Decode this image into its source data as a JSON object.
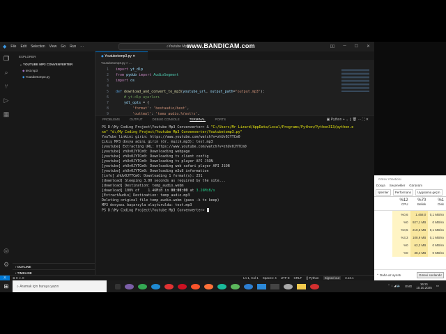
{
  "titlebar": {
    "menus": [
      "File",
      "Edit",
      "Selection",
      "View",
      "Go",
      "Run",
      "···"
    ],
    "search": "Youtube Mp3",
    "watermark": "www.BANDICAM.com"
  },
  "sidebar": {
    "header": "EXPLORER",
    "folder": "YOUTUBE MP3 CONVENVERTER",
    "files": [
      "test.mp3",
      "Youtubetomp3.py"
    ],
    "outline": "OUTLINE",
    "timeline": "TIMELINE"
  },
  "editor": {
    "tab": "Youtubetomp3.py",
    "breadcrumb": "Youtubetomp3.py > ...",
    "lines": [
      [
        {
          "c": "kw",
          "t": "import "
        },
        {
          "c": "vr",
          "t": "yt_dlp"
        }
      ],
      [
        {
          "c": "kw",
          "t": "from "
        },
        {
          "c": "vr",
          "t": "pydub "
        },
        {
          "c": "kw",
          "t": "import "
        },
        {
          "c": "cl",
          "t": "AudioSegment"
        }
      ],
      [
        {
          "c": "kw",
          "t": "import "
        },
        {
          "c": "vr",
          "t": "os"
        }
      ],
      [],
      [
        {
          "c": "bl",
          "t": "def "
        },
        {
          "c": "fn",
          "t": "download_and_convert_to_mp3"
        },
        {
          "c": "",
          "t": "("
        },
        {
          "c": "vr",
          "t": "youtube_url"
        },
        {
          "c": "",
          "t": ", "
        },
        {
          "c": "vr",
          "t": "output_path"
        },
        {
          "c": "",
          "t": "="
        },
        {
          "c": "st",
          "t": "\"output.mp3\""
        },
        {
          "c": "",
          "t": "):"
        }
      ],
      [
        {
          "c": "cm",
          "t": "    # yt-dlp ayarları"
        }
      ],
      [
        {
          "c": "vr",
          "t": "    ydl_opts"
        },
        {
          "c": "",
          "t": " = {"
        }
      ],
      [
        {
          "c": "st",
          "t": "        'format'"
        },
        {
          "c": "",
          "t": ": "
        },
        {
          "c": "st",
          "t": "'bestaudio/best'"
        },
        {
          "c": "",
          "t": ","
        }
      ],
      [
        {
          "c": "st",
          "t": "        'outtmpl'"
        },
        {
          "c": "",
          "t": ": "
        },
        {
          "c": "st",
          "t": "'temp_audio.%(ext)s'"
        },
        {
          "c": "",
          "t": ","
        }
      ]
    ]
  },
  "panel": {
    "tabs": [
      "PROBLEMS",
      "OUTPUT",
      "DEBUG CONSOLE",
      "TERMINAL",
      "PORTS"
    ],
    "shell": "Python",
    "terminal": [
      "PS D:\\My Coding Project\\Youtube Mp3 Convenverter> & \"C:/Users/Mr Lizard/AppData/Local/Programs/Python/Python313/python.e",
      "xe\" \"d:/My Coding Project/Youtube Mp3 Convenverter/Youtubetomp3.py\"",
      "YouTube linkini girin: https://www.youtube.com/watch?v=zhUv0JYTCm0",
      "Çıkış MP3 dosya adını girin (ör. muzik.mp3): test.mp3",
      "[youtube] Extracting URL: https://www.youtube.com/watch?v=zhUv0JYTCm0",
      "[youtube] zhUv0JYTCm0: Downloading webpage",
      "[youtube] zhUv0JYTCm0: Downloading tv client config",
      "[youtube] zhUv0JYTCm0: Downloading tv player API JSON",
      "[youtube] zhUv0JYTCm0: Downloading web safari player API JSON",
      "[youtube] zhUv0JYTCm0: Downloading m3u8 information",
      "[info] zhUv0JYTCm0: Downloading 1 format(s): 251",
      "[download] Sleeping 3.00 seconds as required by the site...",
      "[download] Destination: temp_audio.webm",
      "[download] 100% of    1.46MiB in 00:00:00 at 3.26MiB/s",
      "[ExtractAudio] Destination: temp_audio.mp3",
      "Deleting original file temp_audio.webm (pass -k to keep)",
      "MP3 dosyası başarıyla oluşturuldu: test.mp3",
      "PS D:\\My Coding Project\\Youtube Mp3 Convenverter> "
    ]
  },
  "status": {
    "errors": "⊗ 0 ⚠ 0",
    "items": [
      "Ln 1, Col 1",
      "Spaces: 4",
      "UTF-8",
      "CRLF",
      "{} Python",
      "Signed out",
      "3.13.1"
    ]
  },
  "taskmanager": {
    "title": "Görev Yöneticisi",
    "menus": [
      "Dosya",
      "Seçenekler",
      "Görünüm"
    ],
    "tabs": [
      "İşlemler",
      "Performans",
      "Uygulama geçm"
    ],
    "headers": [
      {
        "pct": "%12",
        "label": "CPU"
      },
      {
        "pct": "%70",
        "label": "Bellek"
      },
      {
        "pct": "%1",
        "label": "Disk"
      }
    ],
    "rows": [
      [
        "%0,6",
        "1.468,0 MB",
        "0,1 MB/sn"
      ],
      [
        "%0",
        "927,1 MB",
        "0 MB/sn"
      ],
      [
        "%0,5",
        "210,6 MB",
        "0,1 MB/sn"
      ],
      [
        "%3,3",
        "108,9 MB",
        "0,1 MB/sn"
      ],
      [
        "%0",
        "62,2 MB",
        "0 MB/sn"
      ],
      [
        "%0",
        "38,4 MB",
        "0 MB/sn"
      ]
    ],
    "fewer": "Daha az ayrıntı",
    "end_task": "Görevi sonlandır"
  },
  "taskbar": {
    "search": "Aramak için buraya yazın",
    "lang": "ENG",
    "time": "16:21",
    "date": "10.10.2025"
  }
}
